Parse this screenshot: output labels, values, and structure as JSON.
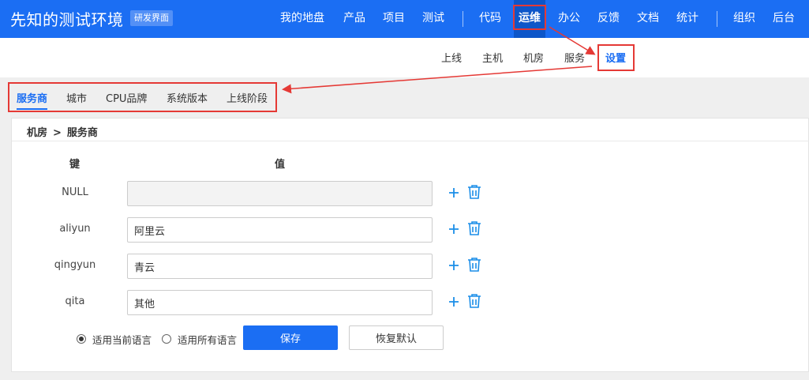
{
  "header": {
    "brand": "先知的测试环境",
    "badge": "研发界面",
    "nav": [
      {
        "label": "我的地盘",
        "active": false
      },
      {
        "label": "产品",
        "active": false
      },
      {
        "label": "项目",
        "active": false
      },
      {
        "label": "测试",
        "active": false
      },
      {
        "label": "代码",
        "active": false
      },
      {
        "label": "运维",
        "active": true
      },
      {
        "label": "办公",
        "active": false
      },
      {
        "label": "反馈",
        "active": false
      },
      {
        "label": "文档",
        "active": false
      },
      {
        "label": "统计",
        "active": false
      },
      {
        "label": "组织",
        "active": false
      },
      {
        "label": "后台",
        "active": false
      }
    ]
  },
  "subnav": {
    "items": [
      {
        "label": "上线",
        "active": false
      },
      {
        "label": "主机",
        "active": false
      },
      {
        "label": "机房",
        "active": false
      },
      {
        "label": "服务",
        "active": false
      },
      {
        "label": "设置",
        "active": true
      }
    ]
  },
  "tabs": [
    {
      "label": "服务商",
      "active": true
    },
    {
      "label": "城市",
      "active": false
    },
    {
      "label": "CPU品牌",
      "active": false
    },
    {
      "label": "系统版本",
      "active": false
    },
    {
      "label": "上线阶段",
      "active": false
    }
  ],
  "breadcrumb": {
    "parent": "机房",
    "separator": ">",
    "current": "服务商"
  },
  "table": {
    "key_header": "键",
    "value_header": "值",
    "rows": [
      {
        "key": "NULL",
        "value": "",
        "disabled": true
      },
      {
        "key": "aliyun",
        "value": "阿里云",
        "disabled": false
      },
      {
        "key": "qingyun",
        "value": "青云",
        "disabled": false
      },
      {
        "key": "qita",
        "value": "其他",
        "disabled": false
      }
    ]
  },
  "language": {
    "options": [
      {
        "label": "适用当前语言",
        "checked": true
      },
      {
        "label": "适用所有语言",
        "checked": false
      }
    ]
  },
  "buttons": {
    "save": "保存",
    "reset": "恢复默认"
  },
  "icons": {
    "add": "plus-icon",
    "delete": "trash-icon"
  },
  "colors": {
    "primary": "#1b6ef3",
    "header_active": "#0d56c9",
    "annotation": "#e53935",
    "icon": "#1b8ee8"
  }
}
